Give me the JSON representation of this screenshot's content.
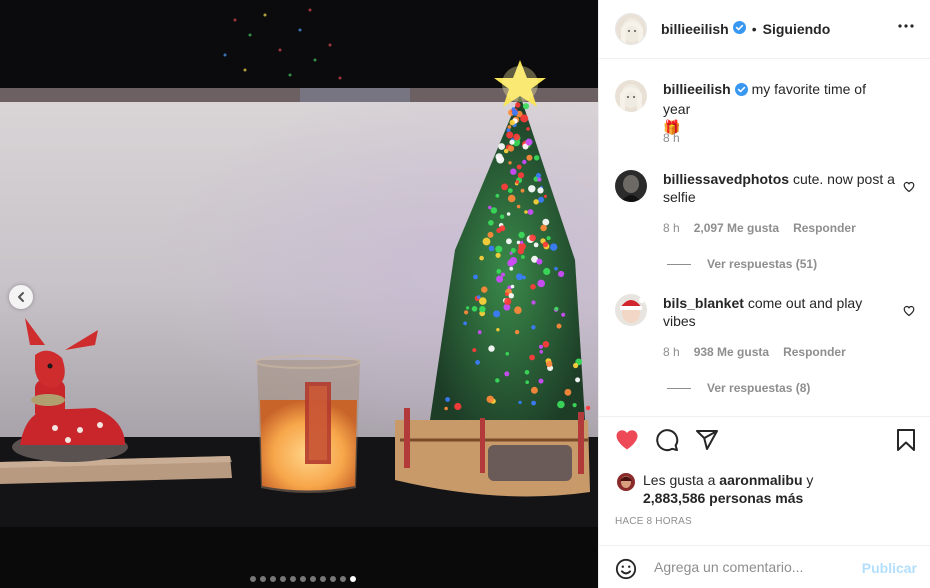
{
  "post": {
    "author": "billieeilish",
    "follow_status": "Siguiendo",
    "separator": "•",
    "image_count": 11,
    "active_image_index": 10
  },
  "caption": {
    "username": "billieeilish",
    "text": "my favorite time of year",
    "emoji": "🎁",
    "age": "8 h"
  },
  "comments": [
    {
      "username": "billiessavedphotos",
      "text": "cute. now post a selfie",
      "age": "8 h",
      "likes": "2,097 Me gusta",
      "reply_label": "Responder",
      "view_replies": "Ver respuestas (51)"
    },
    {
      "username": "bils_blanket",
      "text": "come out and play vibes",
      "age": "8 h",
      "likes": "938 Me gusta",
      "reply_label": "Responder",
      "view_replies": "Ver respuestas (8)"
    }
  ],
  "likes_summary": {
    "prefix": "Les gusta a",
    "user": "aaronmalibu",
    "conj": "y",
    "others": "2,883,586 personas más"
  },
  "timestamp": "HACE 8 HORAS",
  "comment_box": {
    "placeholder": "Agrega un comentario...",
    "publish_label": "Publicar"
  },
  "colors": {
    "accent_heart": "#ed4956",
    "verified": "#3897f0",
    "publish_disabled": "#b2dffc",
    "muted_text": "#8e8e8e"
  },
  "icons": {
    "like": "heart-filled-icon",
    "comment": "comment-bubble-icon",
    "share": "paper-plane-icon",
    "save": "bookmark-icon",
    "more": "more-horizontal-icon",
    "emoji": "smiley-icon",
    "prev": "chevron-left-icon"
  }
}
